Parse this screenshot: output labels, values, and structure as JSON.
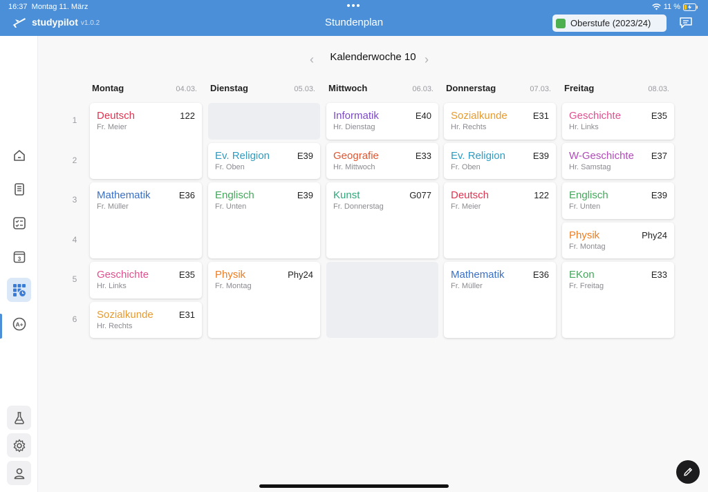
{
  "status_bar": {
    "time": "16:37",
    "date": "Montag 11. März",
    "battery": "11 %"
  },
  "header": {
    "app_name": "studypilot",
    "version": "v1.0.2",
    "title": "Stundenplan",
    "term": "Oberstufe (2023/24)",
    "term_color": "#4caf50",
    "accent": "#4a8fd8"
  },
  "sidebar": {
    "items": [
      {
        "icon": "home-icon"
      },
      {
        "icon": "notebook-icon"
      },
      {
        "icon": "tasks-icon"
      },
      {
        "icon": "calendar-icon",
        "label": "3"
      },
      {
        "icon": "timetable-icon",
        "active": true
      },
      {
        "icon": "grades-icon",
        "label": "A+"
      }
    ],
    "bottom_items": [
      {
        "icon": "flask-icon"
      },
      {
        "icon": "settings-icon"
      },
      {
        "icon": "profile-icon"
      }
    ]
  },
  "week": {
    "label": "Kalenderwoche 10"
  },
  "periods": [
    "1",
    "2",
    "3",
    "4",
    "5",
    "6"
  ],
  "days": [
    {
      "name": "Montag",
      "date": "04.03.",
      "lessons": [
        {
          "start": 1,
          "len": 2,
          "subject": "Deutsch",
          "room": "122",
          "teacher": "Fr. Meier",
          "color": "#e0334f"
        },
        {
          "start": 3,
          "len": 2,
          "subject": "Mathematik",
          "room": "E36",
          "teacher": "Fr. Müller",
          "color": "#3b6fc4"
        },
        {
          "start": 5,
          "len": 1,
          "subject": "Geschichte",
          "room": "E35",
          "teacher": "Hr. Links",
          "color": "#e0508f"
        },
        {
          "start": 6,
          "len": 1,
          "subject": "Sozialkunde",
          "room": "E31",
          "teacher": "Hr. Rechts",
          "color": "#e89a2c"
        }
      ]
    },
    {
      "name": "Dienstag",
      "date": "05.03.",
      "lessons": [
        {
          "start": 1,
          "len": 1,
          "free": true
        },
        {
          "start": 2,
          "len": 1,
          "subject": "Ev. Religion",
          "room": "E39",
          "teacher": "Fr. Oben",
          "color": "#2f9bc0"
        },
        {
          "start": 3,
          "len": 2,
          "subject": "Englisch",
          "room": "E39",
          "teacher": "Fr. Unten",
          "color": "#43a85a"
        },
        {
          "start": 5,
          "len": 2,
          "subject": "Physik",
          "room": "Phy24",
          "teacher": "Fr. Montag",
          "color": "#ef7d22"
        }
      ]
    },
    {
      "name": "Mittwoch",
      "date": "06.03.",
      "lessons": [
        {
          "start": 1,
          "len": 1,
          "subject": "Informatik",
          "room": "E40",
          "teacher": "Hr. Dienstag",
          "color": "#7b4bc4"
        },
        {
          "start": 2,
          "len": 1,
          "subject": "Geografie",
          "room": "E33",
          "teacher": "Hr. Mittwoch",
          "color": "#e0552f"
        },
        {
          "start": 3,
          "len": 2,
          "subject": "Kunst",
          "room": "G077",
          "teacher": "Fr. Donnerstag",
          "color": "#2fa87a"
        },
        {
          "start": 5,
          "len": 2,
          "free": true
        }
      ]
    },
    {
      "name": "Donnerstag",
      "date": "07.03.",
      "lessons": [
        {
          "start": 1,
          "len": 1,
          "subject": "Sozialkunde",
          "room": "E31",
          "teacher": "Hr. Rechts",
          "color": "#e89a2c"
        },
        {
          "start": 2,
          "len": 1,
          "subject": "Ev. Religion",
          "room": "E39",
          "teacher": "Fr. Oben",
          "color": "#2f9bc0"
        },
        {
          "start": 3,
          "len": 2,
          "subject": "Deutsch",
          "room": "122",
          "teacher": "Fr. Meier",
          "color": "#e0334f"
        },
        {
          "start": 5,
          "len": 2,
          "subject": "Mathematik",
          "room": "E36",
          "teacher": "Fr. Müller",
          "color": "#3b6fc4"
        }
      ]
    },
    {
      "name": "Freitag",
      "date": "08.03.",
      "lessons": [
        {
          "start": 1,
          "len": 1,
          "subject": "Geschichte",
          "room": "E35",
          "teacher": "Hr. Links",
          "color": "#e0508f"
        },
        {
          "start": 2,
          "len": 1,
          "subject": "W-Geschichte",
          "room": "E37",
          "teacher": "Hr. Samstag",
          "color": "#b04bb8"
        },
        {
          "start": 3,
          "len": 1,
          "subject": "Englisch",
          "room": "E39",
          "teacher": "Fr. Unten",
          "color": "#43a85a"
        },
        {
          "start": 4,
          "len": 1,
          "subject": "Physik",
          "room": "Phy24",
          "teacher": "Fr. Montag",
          "color": "#ef7d22"
        },
        {
          "start": 5,
          "len": 2,
          "subject": "EKon",
          "room": "E33",
          "teacher": "Fr. Freitag",
          "color": "#43a85a"
        }
      ]
    }
  ]
}
